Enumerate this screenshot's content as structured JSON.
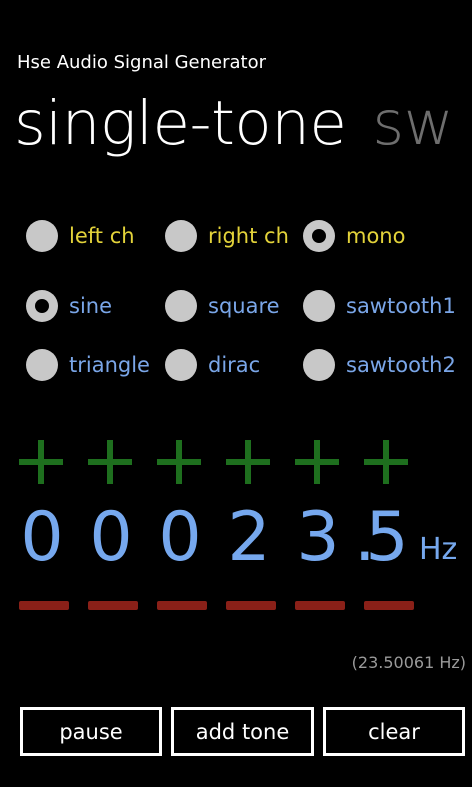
{
  "app": {
    "title": "Hse Audio Signal Generator"
  },
  "pivot": {
    "active": "single-tone",
    "next": "sw"
  },
  "channel_options": [
    {
      "label": "left ch",
      "checked": false
    },
    {
      "label": "right ch",
      "checked": false
    },
    {
      "label": "mono",
      "checked": true
    }
  ],
  "waveform_options": [
    {
      "label": "sine",
      "checked": true
    },
    {
      "label": "square",
      "checked": false
    },
    {
      "label": "sawtooth1",
      "checked": false
    },
    {
      "label": "triangle",
      "checked": false
    },
    {
      "label": "dirac",
      "checked": false
    },
    {
      "label": "sawtooth2",
      "checked": false
    }
  ],
  "frequency": {
    "digits": [
      "0",
      "0",
      "0",
      "2",
      "3",
      "5"
    ],
    "decimal_separator": ".",
    "unit": "Hz",
    "exact": "(23.50061 Hz)"
  },
  "buttons": {
    "pause": "pause",
    "add_tone": "add tone",
    "clear": "clear"
  },
  "colors": {
    "background": "#000000",
    "channel_label": "#e3d33a",
    "waveform_label": "#7aa6e8",
    "digits": "#76a8ee",
    "plus": "#1e6f1e",
    "minus": "#8a2018",
    "radio_fill": "#c8c8c8"
  }
}
